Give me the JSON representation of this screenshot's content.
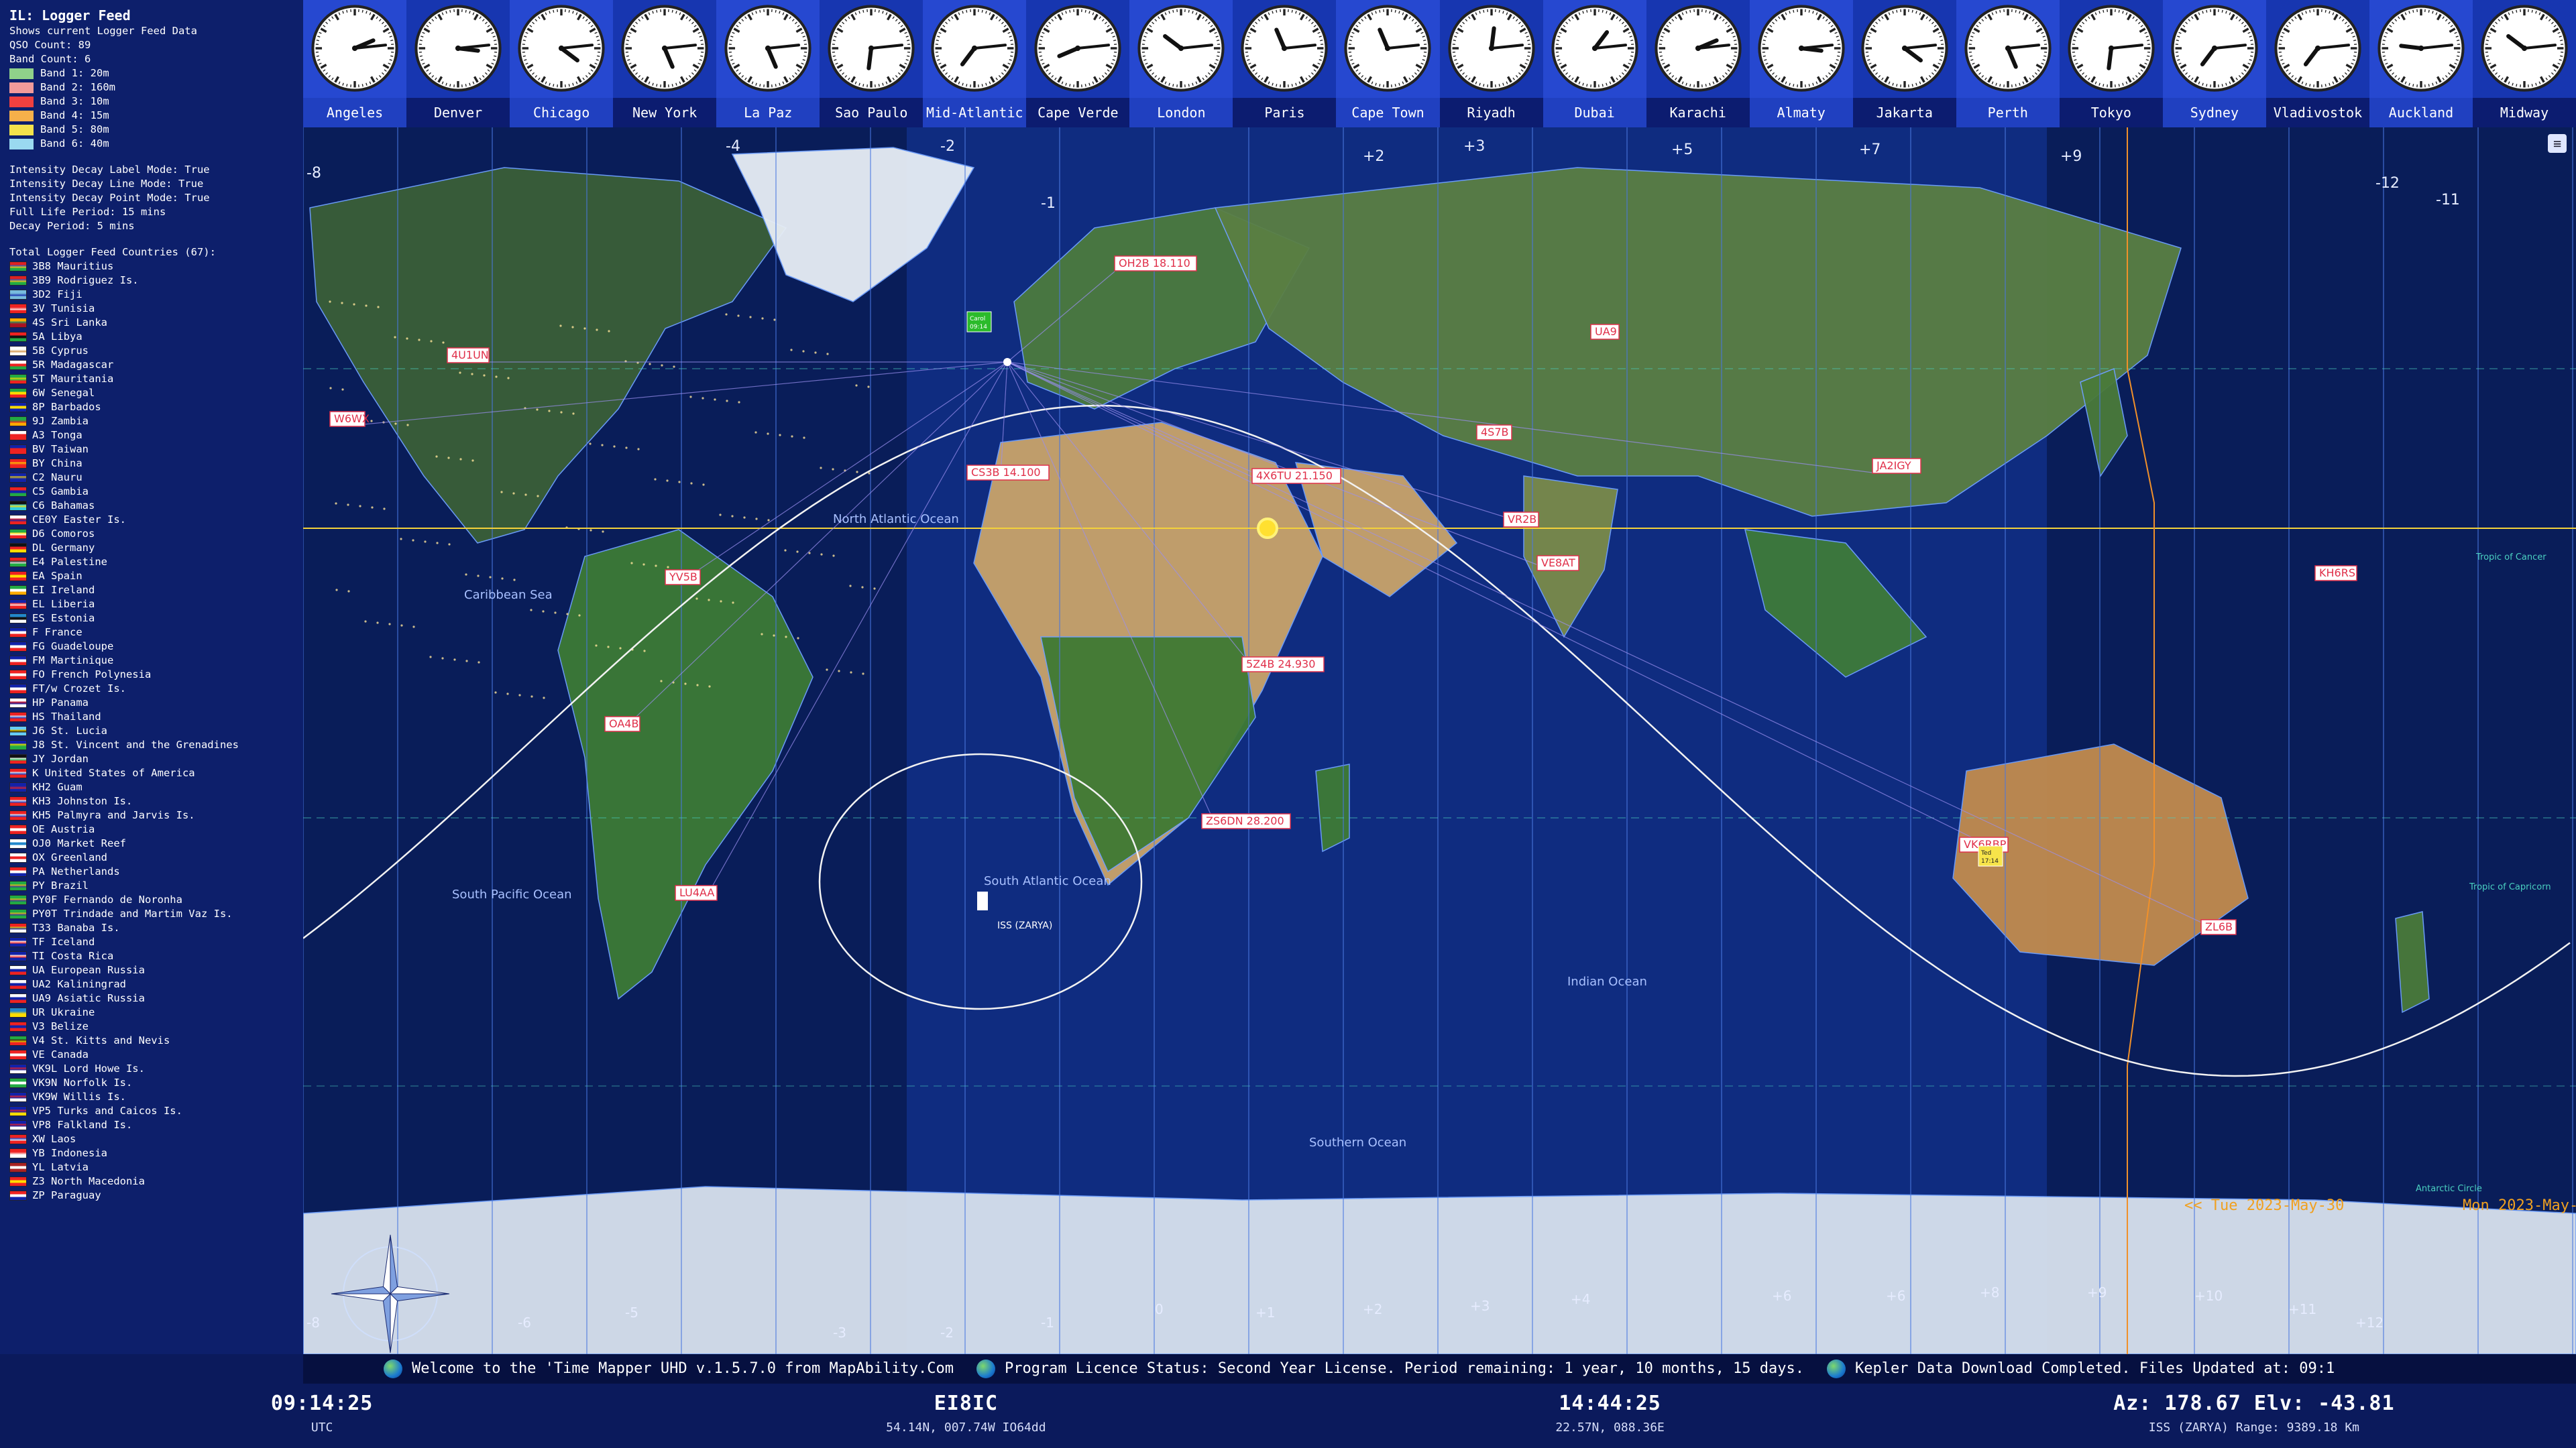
{
  "left_panel": {
    "title": "IL: Logger Feed",
    "subtitle": "Shows current Logger Feed Data",
    "qso_count": "QSO Count: 89",
    "band_count": "Band Count: 6",
    "bands": [
      {
        "label": "Band 1: 20m",
        "color": "#8fd18a"
      },
      {
        "label": "Band 2: 160m",
        "color": "#f29a9a"
      },
      {
        "label": "Band 3: 10m",
        "color": "#f04040"
      },
      {
        "label": "Band 4: 15m",
        "color": "#f6b04a"
      },
      {
        "label": "Band 5: 80m",
        "color": "#f3e24c"
      },
      {
        "label": "Band 6: 40m",
        "color": "#9ad9f0"
      }
    ],
    "settings": [
      "Intensity Decay Label Mode: True",
      "Intensity Decay Line Mode: True",
      "Intensity Decay Point Mode: True",
      "Full Life Period: 15 mins",
      "Decay Period: 5 mins"
    ],
    "countries_heading": "Total Logger Feed Countries (67):",
    "countries": [
      {
        "label": "3B8 Mauritius",
        "colors": [
          "#d22",
          "#23c",
          "#fd0",
          "#2a4"
        ]
      },
      {
        "label": "3B9 Rodriguez Is.",
        "colors": [
          "#d22",
          "#23c",
          "#fd0",
          "#2a4"
        ]
      },
      {
        "label": "3D2 Fiji",
        "colors": [
          "#7bd",
          "#7bd",
          "#12a",
          "#7bd"
        ]
      },
      {
        "label": "3V Tunisia",
        "colors": [
          "#e22",
          "#e22",
          "#fff",
          "#e22"
        ]
      },
      {
        "label": "4S Sri Lanka",
        "colors": [
          "#fa0",
          "#2a6",
          "#a12",
          "#a12"
        ]
      },
      {
        "label": "5A Libya",
        "colors": [
          "#e22",
          "#111",
          "#111",
          "#2a4"
        ]
      },
      {
        "label": "5B Cyprus",
        "colors": [
          "#fff",
          "#fff",
          "#c83",
          "#fff"
        ]
      },
      {
        "label": "5R Madagascar",
        "colors": [
          "#fff",
          "#e22",
          "#e22",
          "#2a4"
        ]
      },
      {
        "label": "5T Mauritania",
        "colors": [
          "#2a4",
          "#fd0",
          "#2a4",
          "#e22"
        ]
      },
      {
        "label": "6W Senegal",
        "colors": [
          "#2a4",
          "#fd0",
          "#fd0",
          "#e22"
        ]
      },
      {
        "label": "8P Barbados",
        "colors": [
          "#12a",
          "#fd0",
          "#fd0",
          "#12a"
        ]
      },
      {
        "label": "9J Zambia",
        "colors": [
          "#2a4",
          "#2a4",
          "#e22",
          "#fa0"
        ]
      },
      {
        "label": "A3 Tonga",
        "colors": [
          "#fff",
          "#e22",
          "#e22",
          "#e22"
        ]
      },
      {
        "label": "BV Taiwan",
        "colors": [
          "#12a",
          "#e22",
          "#e22",
          "#e22"
        ]
      },
      {
        "label": "BY China",
        "colors": [
          "#e22",
          "#fd0",
          "#e22",
          "#e22"
        ]
      },
      {
        "label": "C2 Nauru",
        "colors": [
          "#12a",
          "#fd0",
          "#12a",
          "#12a"
        ]
      },
      {
        "label": "C5 Gambia",
        "colors": [
          "#e22",
          "#12a",
          "#12a",
          "#2a4"
        ]
      },
      {
        "label": "C6 Bahamas",
        "colors": [
          "#111",
          "#3cd",
          "#fd0",
          "#3cd"
        ]
      },
      {
        "label": "CE0Y Easter Is.",
        "colors": [
          "#fff",
          "#e22",
          "#12a",
          "#e22"
        ]
      },
      {
        "label": "D6 Comoros",
        "colors": [
          "#2a4",
          "#fd0",
          "#fff",
          "#e22"
        ]
      },
      {
        "label": "DL Germany",
        "colors": [
          "#111",
          "#e22",
          "#e22",
          "#fd0"
        ]
      },
      {
        "label": "E4 Palestine",
        "colors": [
          "#e22",
          "#111",
          "#fff",
          "#2a4"
        ]
      },
      {
        "label": "EA Spain",
        "colors": [
          "#e22",
          "#fd0",
          "#fd0",
          "#e22"
        ]
      },
      {
        "label": "EI Ireland",
        "colors": [
          "#2a4",
          "#fff",
          "#fff",
          "#fa0"
        ]
      },
      {
        "label": "EL Liberia",
        "colors": [
          "#12a",
          "#e22",
          "#fff",
          "#e22"
        ]
      },
      {
        "label": "ES Estonia",
        "colors": [
          "#28c",
          "#111",
          "#111",
          "#fff"
        ]
      },
      {
        "label": "F France",
        "colors": [
          "#12a",
          "#fff",
          "#fff",
          "#e22"
        ]
      },
      {
        "label": "FG Guadeloupe",
        "colors": [
          "#12a",
          "#fff",
          "#fff",
          "#e22"
        ]
      },
      {
        "label": "FM Martinique",
        "colors": [
          "#12a",
          "#fff",
          "#fff",
          "#e22"
        ]
      },
      {
        "label": "FO French Polynesia",
        "colors": [
          "#e22",
          "#fff",
          "#fff",
          "#e22"
        ]
      },
      {
        "label": "FT/w Crozet Is.",
        "colors": [
          "#12a",
          "#fff",
          "#fff",
          "#e22"
        ]
      },
      {
        "label": "HP Panama",
        "colors": [
          "#fff",
          "#e22",
          "#12a",
          "#fff"
        ]
      },
      {
        "label": "HS Thailand",
        "colors": [
          "#e22",
          "#fff",
          "#12a",
          "#e22"
        ]
      },
      {
        "label": "J6 St. Lucia",
        "colors": [
          "#6cf",
          "#fd0",
          "#111",
          "#6cf"
        ]
      },
      {
        "label": "J8 St. Vincent and the Grenadines",
        "colors": [
          "#12a",
          "#fd0",
          "#2a4",
          "#2a4"
        ]
      },
      {
        "label": "JY Jordan",
        "colors": [
          "#111",
          "#fff",
          "#2a4",
          "#e22"
        ]
      },
      {
        "label": "K United States of America",
        "colors": [
          "#e22",
          "#fff",
          "#12a",
          "#e22"
        ]
      },
      {
        "label": "KH2 Guam",
        "colors": [
          "#12a",
          "#12a",
          "#e22",
          "#12a"
        ]
      },
      {
        "label": "KH3 Johnston Is.",
        "colors": [
          "#e22",
          "#fff",
          "#12a",
          "#e22"
        ]
      },
      {
        "label": "KH5 Palmyra and Jarvis Is.",
        "colors": [
          "#e22",
          "#fff",
          "#12a",
          "#e22"
        ]
      },
      {
        "label": "OE Austria",
        "colors": [
          "#e22",
          "#fff",
          "#fff",
          "#e22"
        ]
      },
      {
        "label": "OJ0 Market Reef",
        "colors": [
          "#fff",
          "#28c",
          "#28c",
          "#fff"
        ]
      },
      {
        "label": "OX Greenland",
        "colors": [
          "#fff",
          "#e22",
          "#e22",
          "#fff"
        ]
      },
      {
        "label": "PA Netherlands",
        "colors": [
          "#e22",
          "#fff",
          "#fff",
          "#12a"
        ]
      },
      {
        "label": "PY Brazil",
        "colors": [
          "#2a4",
          "#fd0",
          "#12a",
          "#2a4"
        ]
      },
      {
        "label": "PY0F Fernando de Noronha",
        "colors": [
          "#2a4",
          "#fd0",
          "#12a",
          "#2a4"
        ]
      },
      {
        "label": "PY0T Trindade and Martim Vaz Is.",
        "colors": [
          "#2a4",
          "#fd0",
          "#12a",
          "#2a4"
        ]
      },
      {
        "label": "T33 Banaba Is.",
        "colors": [
          "#e22",
          "#fd0",
          "#12a",
          "#fff"
        ]
      },
      {
        "label": "TF Iceland",
        "colors": [
          "#12a",
          "#fff",
          "#e22",
          "#12a"
        ]
      },
      {
        "label": "TI Costa Rica",
        "colors": [
          "#12a",
          "#fff",
          "#e22",
          "#12a"
        ]
      },
      {
        "label": "UA European Russia",
        "colors": [
          "#fff",
          "#12a",
          "#12a",
          "#e22"
        ]
      },
      {
        "label": "UA2 Kaliningrad",
        "colors": [
          "#fff",
          "#12a",
          "#12a",
          "#e22"
        ]
      },
      {
        "label": "UA9 Asiatic Russia",
        "colors": [
          "#fff",
          "#12a",
          "#12a",
          "#e22"
        ]
      },
      {
        "label": "UR Ukraine",
        "colors": [
          "#28c",
          "#28c",
          "#fd0",
          "#fd0"
        ]
      },
      {
        "label": "V3 Belize",
        "colors": [
          "#e22",
          "#12a",
          "#12a",
          "#e22"
        ]
      },
      {
        "label": "V4 St. Kitts and Nevis",
        "colors": [
          "#2a4",
          "#111",
          "#fd0",
          "#e22"
        ]
      },
      {
        "label": "VE Canada",
        "colors": [
          "#e22",
          "#fff",
          "#fff",
          "#e22"
        ]
      },
      {
        "label": "VK9L Lord Howe Is.",
        "colors": [
          "#12a",
          "#e22",
          "#12a",
          "#fff"
        ]
      },
      {
        "label": "VK9N Norfolk Is.",
        "colors": [
          "#2a4",
          "#fff",
          "#fff",
          "#2a4"
        ]
      },
      {
        "label": "VK9W Willis Is.",
        "colors": [
          "#12a",
          "#e22",
          "#12a",
          "#fff"
        ]
      },
      {
        "label": "VP5 Turks and Caicos Is.",
        "colors": [
          "#12a",
          "#e22",
          "#12a",
          "#fd0"
        ]
      },
      {
        "label": "VP8 Falkland Is.",
        "colors": [
          "#12a",
          "#e22",
          "#12a",
          "#fff"
        ]
      },
      {
        "label": "XW Laos",
        "colors": [
          "#e22",
          "#12a",
          "#fff",
          "#e22"
        ]
      },
      {
        "label": "YB Indonesia",
        "colors": [
          "#e22",
          "#e22",
          "#fff",
          "#fff"
        ]
      },
      {
        "label": "YL Latvia",
        "colors": [
          "#a22",
          "#fff",
          "#fff",
          "#a22"
        ]
      },
      {
        "label": "Z3 North Macedonia",
        "colors": [
          "#e22",
          "#fd0",
          "#fd0",
          "#e22"
        ]
      },
      {
        "label": "ZP Paraguay",
        "colors": [
          "#e22",
          "#fff",
          "#fff",
          "#12a"
        ]
      }
    ]
  },
  "clocks": [
    {
      "city": "Angeles",
      "hour": 2,
      "minute": 14
    },
    {
      "city": "Denver",
      "hour": 3,
      "minute": 14
    },
    {
      "city": "Chicago",
      "hour": 4,
      "minute": 14
    },
    {
      "city": "New York",
      "hour": 5,
      "minute": 14
    },
    {
      "city": "La Paz",
      "hour": 5,
      "minute": 14
    },
    {
      "city": "Sao Paulo",
      "hour": 6,
      "minute": 14
    },
    {
      "city": "Mid-Atlantic",
      "hour": 7,
      "minute": 14
    },
    {
      "city": "Cape Verde",
      "hour": 8,
      "minute": 14
    },
    {
      "city": "London",
      "hour": 10,
      "minute": 14
    },
    {
      "city": "Paris",
      "hour": 11,
      "minute": 14
    },
    {
      "city": "Cape Town",
      "hour": 11,
      "minute": 14
    },
    {
      "city": "Riyadh",
      "hour": 12,
      "minute": 14
    },
    {
      "city": "Dubai",
      "hour": 1,
      "minute": 14
    },
    {
      "city": "Karachi",
      "hour": 2,
      "minute": 14
    },
    {
      "city": "Almaty",
      "hour": 3,
      "minute": 14
    },
    {
      "city": "Jakarta",
      "hour": 4,
      "minute": 14
    },
    {
      "city": "Perth",
      "hour": 5,
      "minute": 14
    },
    {
      "city": "Tokyo",
      "hour": 6,
      "minute": 14
    },
    {
      "city": "Sydney",
      "hour": 7,
      "minute": 14
    },
    {
      "city": "Vladivostok",
      "hour": 7,
      "minute": 14
    },
    {
      "city": "Auckland",
      "hour": 9,
      "minute": 14
    },
    {
      "city": "Midway",
      "hour": 10,
      "minute": 14
    }
  ],
  "map": {
    "oceans": [
      "North Atlantic Ocean",
      "Caribbean Sea",
      "South Pacific Ocean",
      "South Atlantic Ocean",
      "Indian Ocean",
      "Southern Ocean"
    ],
    "top_offsets": [
      "-8",
      "-4",
      "-2",
      "-1",
      "+2",
      "+3",
      "+5",
      "+7",
      "+9",
      "-12",
      "-11"
    ],
    "bottom_offsets": [
      "-8",
      "-6",
      "-5",
      "-3",
      "-2",
      "-1",
      "0",
      "+1",
      "+2",
      "+3",
      "+4",
      "+6",
      "+6",
      "+8",
      "+9",
      "+10",
      "+11",
      "+12"
    ],
    "spots": [
      "OH2B 18.110",
      "CS3B 14.100",
      "4X6TU 21.150",
      "5Z4B 24.930",
      "ZS6DN 28.200",
      "VR2B",
      "JA2IGY",
      "4U1UN",
      "W6WX",
      "OA4B",
      "LU4AA",
      "YV5B",
      "VE8AT",
      "VK6RBP",
      "ZL6B",
      "4S7B",
      "KH6RS",
      "UA9"
    ],
    "ted_marker": "Ted\n17:14",
    "carol_marker": "Carol\n09:14",
    "iss_label": "ISS (ZARYA)",
    "date_left": "<<  Tue 2023-May-30",
    "date_right": "Mon 2023-May-",
    "antarctic_label": "Antarctic Circle",
    "tropic_cancer": "Tropic of Cancer",
    "tropic_capricorn": "Tropic of Capricorn"
  },
  "ticker": {
    "messages": [
      "Welcome to the 'Time Mapper UHD v.1.5.7.0 from MapAbility.Com",
      "Program Licence Status: Second Year License.  Period remaining: 1 year, 10 months, 15 days.",
      "Kepler Data Download Completed. Files Updated at: 09:1"
    ]
  },
  "status": {
    "utc_time": "09:14:25",
    "utc_label": "UTC",
    "callsign": "EI8IC",
    "location": "54.14N, 007.74W  IO64dd",
    "local_time": "14:44:25",
    "local_coords": "22.57N, 088.36E",
    "azimuth": "Az: 178.67  Elv: -43.81",
    "sat_info": "ISS (ZARYA)  Range: 9389.18 Km"
  },
  "colors": {
    "panel_bg": "#0d1f6b",
    "clock_strip": "#1736b0",
    "ocean": "#0f2c80",
    "land": "#3c6e3a",
    "desert": "#c9a46a",
    "ice": "#e8eef5",
    "grid": "#4a78e0",
    "sun_line": "#f4d23a",
    "iss_track": "#f2f2f2",
    "spot_bg": "#ffffff",
    "spot_text": "#e0304a"
  }
}
